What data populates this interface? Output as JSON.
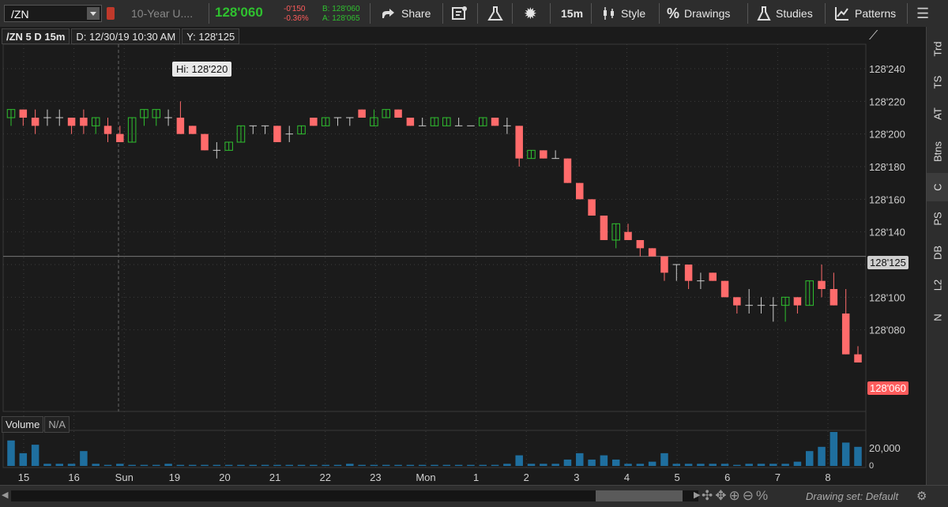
{
  "toolbar": {
    "symbol": "/ZN",
    "description": "10-Year U....",
    "last_price": "128'060",
    "net_change": "-0'150",
    "percent_change": "-0.36%",
    "bid": "B: 128'060",
    "ask": "A: 128'065",
    "share_label": "Share",
    "timeframe_label": "15m",
    "style_label": "Style",
    "drawings_label": "Drawings",
    "studies_label": "Studies",
    "patterns_label": "Patterns"
  },
  "infobar": {
    "symbol_label": "/ZN 5 D 15m",
    "date_label": "D: 12/30/19 10:30 AM",
    "y_label": "Y: 128'125"
  },
  "hi_label": "Hi: 128'220",
  "cursor_price": "128'125",
  "last_price_label": "128'060",
  "volume_header": {
    "label": "Volume",
    "value": "N/A"
  },
  "volume_tick": "20,000",
  "volume_zero": "0",
  "right_tabs": [
    "Trd",
    "TS",
    "AT",
    "Btns",
    "C",
    "PS",
    "DB",
    "L2",
    "N"
  ],
  "selected_tab": "C",
  "drawing_set_label": "Drawing set: Default",
  "colors": {
    "up": "#2fc12f",
    "down": "#ff6b6b",
    "doji": "#cccccc",
    "volume": "#1f6f9f"
  },
  "chart_data": {
    "type": "candlestick",
    "y_axis_ticks": [
      "128'240",
      "128'220",
      "128'200",
      "128'180",
      "128'160",
      "128'140",
      "128'120",
      "128'100",
      "128'080"
    ],
    "ylim": [
      128.03,
      128.255
    ],
    "x_labels": [
      "15",
      "16",
      "Sun",
      "19",
      "20",
      "21",
      "22",
      "23",
      "Mon",
      "1",
      "2",
      "3",
      "4",
      "5",
      "6",
      "7",
      "8"
    ],
    "candles": [
      {
        "o": 128.21,
        "h": 128.215,
        "l": 128.205,
        "c": 128.215
      },
      {
        "o": 128.215,
        "h": 128.215,
        "l": 128.205,
        "c": 128.21
      },
      {
        "o": 128.21,
        "h": 128.215,
        "l": 128.2,
        "c": 128.205
      },
      {
        "o": 128.21,
        "h": 128.215,
        "l": 128.205,
        "c": 128.21
      },
      {
        "o": 128.21,
        "h": 128.215,
        "l": 128.205,
        "c": 128.21
      },
      {
        "o": 128.21,
        "h": 128.21,
        "l": 128.2,
        "c": 128.205
      },
      {
        "o": 128.21,
        "h": 128.215,
        "l": 128.2,
        "c": 128.205
      },
      {
        "o": 128.205,
        "h": 128.21,
        "l": 128.2,
        "c": 128.21
      },
      {
        "o": 128.205,
        "h": 128.21,
        "l": 128.195,
        "c": 128.2
      },
      {
        "o": 128.2,
        "h": 128.205,
        "l": 128.195,
        "c": 128.195
      },
      {
        "o": 128.195,
        "h": 128.21,
        "l": 128.195,
        "c": 128.21
      },
      {
        "o": 128.21,
        "h": 128.215,
        "l": 128.205,
        "c": 128.215
      },
      {
        "o": 128.21,
        "h": 128.215,
        "l": 128.205,
        "c": 128.215
      },
      {
        "o": 128.21,
        "h": 128.215,
        "l": 128.205,
        "c": 128.21
      },
      {
        "o": 128.21,
        "h": 128.22,
        "l": 128.2,
        "c": 128.2
      },
      {
        "o": 128.205,
        "h": 128.205,
        "l": 128.2,
        "c": 128.2
      },
      {
        "o": 128.2,
        "h": 128.2,
        "l": 128.19,
        "c": 128.19
      },
      {
        "o": 128.19,
        "h": 128.195,
        "l": 128.185,
        "c": 128.19
      },
      {
        "o": 128.19,
        "h": 128.195,
        "l": 128.19,
        "c": 128.195
      },
      {
        "o": 128.195,
        "h": 128.205,
        "l": 128.195,
        "c": 128.205
      },
      {
        "o": 128.205,
        "h": 128.205,
        "l": 128.2,
        "c": 128.205
      },
      {
        "o": 128.205,
        "h": 128.205,
        "l": 128.2,
        "c": 128.205
      },
      {
        "o": 128.205,
        "h": 128.205,
        "l": 128.195,
        "c": 128.195
      },
      {
        "o": 128.2,
        "h": 128.205,
        "l": 128.195,
        "c": 128.2
      },
      {
        "o": 128.2,
        "h": 128.205,
        "l": 128.2,
        "c": 128.205
      },
      {
        "o": 128.21,
        "h": 128.21,
        "l": 128.205,
        "c": 128.205
      },
      {
        "o": 128.205,
        "h": 128.21,
        "l": 128.205,
        "c": 128.21
      },
      {
        "o": 128.21,
        "h": 128.21,
        "l": 128.205,
        "c": 128.21
      },
      {
        "o": 128.21,
        "h": 128.21,
        "l": 128.205,
        "c": 128.21
      },
      {
        "o": 128.215,
        "h": 128.215,
        "l": 128.21,
        "c": 128.21
      },
      {
        "o": 128.205,
        "h": 128.215,
        "l": 128.205,
        "c": 128.21
      },
      {
        "o": 128.21,
        "h": 128.215,
        "l": 128.21,
        "c": 128.215
      },
      {
        "o": 128.215,
        "h": 128.215,
        "l": 128.21,
        "c": 128.21
      },
      {
        "o": 128.21,
        "h": 128.21,
        "l": 128.205,
        "c": 128.205
      },
      {
        "o": 128.205,
        "h": 128.21,
        "l": 128.205,
        "c": 128.205
      },
      {
        "o": 128.205,
        "h": 128.21,
        "l": 128.205,
        "c": 128.21
      },
      {
        "o": 128.205,
        "h": 128.21,
        "l": 128.205,
        "c": 128.21
      },
      {
        "o": 128.205,
        "h": 128.21,
        "l": 128.205,
        "c": 128.205
      },
      {
        "o": 128.205,
        "h": 128.205,
        "l": 128.205,
        "c": 128.205
      },
      {
        "o": 128.205,
        "h": 128.21,
        "l": 128.205,
        "c": 128.21
      },
      {
        "o": 128.21,
        "h": 128.21,
        "l": 128.205,
        "c": 128.205
      },
      {
        "o": 128.205,
        "h": 128.21,
        "l": 128.2,
        "c": 128.205
      },
      {
        "o": 128.205,
        "h": 128.205,
        "l": 128.18,
        "c": 128.185
      },
      {
        "o": 128.185,
        "h": 128.19,
        "l": 128.185,
        "c": 128.19
      },
      {
        "o": 128.19,
        "h": 128.19,
        "l": 128.185,
        "c": 128.185
      },
      {
        "o": 128.185,
        "h": 128.19,
        "l": 128.185,
        "c": 128.185
      },
      {
        "o": 128.185,
        "h": 128.185,
        "l": 128.17,
        "c": 128.17
      },
      {
        "o": 128.17,
        "h": 128.17,
        "l": 128.16,
        "c": 128.16
      },
      {
        "o": 128.16,
        "h": 128.16,
        "l": 128.15,
        "c": 128.15
      },
      {
        "o": 128.15,
        "h": 128.15,
        "l": 128.135,
        "c": 128.135
      },
      {
        "o": 128.135,
        "h": 128.145,
        "l": 128.13,
        "c": 128.145
      },
      {
        "o": 128.14,
        "h": 128.145,
        "l": 128.135,
        "c": 128.135
      },
      {
        "o": 128.135,
        "h": 128.135,
        "l": 128.125,
        "c": 128.13
      },
      {
        "o": 128.13,
        "h": 128.13,
        "l": 128.125,
        "c": 128.125
      },
      {
        "o": 128.125,
        "h": 128.125,
        "l": 128.11,
        "c": 128.115
      },
      {
        "o": 128.12,
        "h": 128.12,
        "l": 128.11,
        "c": 128.12
      },
      {
        "o": 128.12,
        "h": 128.12,
        "l": 128.105,
        "c": 128.11
      },
      {
        "o": 128.11,
        "h": 128.115,
        "l": 128.105,
        "c": 128.11
      },
      {
        "o": 128.115,
        "h": 128.115,
        "l": 128.11,
        "c": 128.11
      },
      {
        "o": 128.11,
        "h": 128.11,
        "l": 128.1,
        "c": 128.1
      },
      {
        "o": 128.1,
        "h": 128.1,
        "l": 128.09,
        "c": 128.095
      },
      {
        "o": 128.095,
        "h": 128.105,
        "l": 128.09,
        "c": 128.095
      },
      {
        "o": 128.095,
        "h": 128.1,
        "l": 128.09,
        "c": 128.095
      },
      {
        "o": 128.095,
        "h": 128.1,
        "l": 128.085,
        "c": 128.095
      },
      {
        "o": 128.095,
        "h": 128.1,
        "l": 128.085,
        "c": 128.1
      },
      {
        "o": 128.1,
        "h": 128.1,
        "l": 128.09,
        "c": 128.095
      },
      {
        "o": 128.095,
        "h": 128.11,
        "l": 128.095,
        "c": 128.11
      },
      {
        "o": 128.11,
        "h": 128.12,
        "l": 128.1,
        "c": 128.105
      },
      {
        "o": 128.105,
        "h": 128.115,
        "l": 128.095,
        "c": 128.095
      },
      {
        "o": 128.09,
        "h": 128.105,
        "l": 128.065,
        "c": 128.065
      },
      {
        "o": 128.065,
        "h": 128.07,
        "l": 128.06,
        "c": 128.06
      }
    ],
    "volume": [
      120,
      60,
      100,
      10,
      10,
      10,
      70,
      10,
      5,
      10,
      5,
      5,
      5,
      10,
      5,
      5,
      5,
      5,
      5,
      5,
      5,
      5,
      5,
      5,
      5,
      5,
      5,
      5,
      10,
      5,
      5,
      5,
      5,
      5,
      5,
      5,
      5,
      5,
      5,
      5,
      5,
      10,
      50,
      10,
      10,
      10,
      30,
      60,
      30,
      50,
      30,
      10,
      10,
      20,
      60,
      10,
      10,
      10,
      10,
      10,
      5,
      10,
      10,
      10,
      10,
      20,
      70,
      90,
      160,
      110,
      90
    ]
  }
}
